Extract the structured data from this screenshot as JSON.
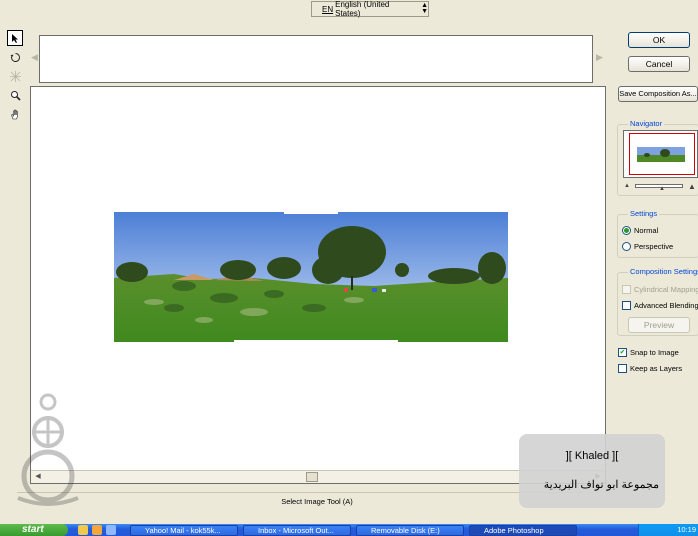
{
  "language_bar": {
    "code": "EN",
    "label": "English (United States)"
  },
  "tools": [
    {
      "name": "select-image-tool-icon"
    },
    {
      "name": "rotate-image-tool-icon"
    },
    {
      "name": "vanishing-point-tool-icon"
    },
    {
      "name": "zoom-tool-icon"
    },
    {
      "name": "hand-tool-icon"
    }
  ],
  "buttons": {
    "ok": "OK",
    "cancel": "Cancel",
    "save_composition": "Save Composition As...",
    "preview": "Preview"
  },
  "navigator": {
    "title": "Navigator"
  },
  "settings": {
    "title": "Settings",
    "options": [
      {
        "label": "Normal",
        "selected": true
      },
      {
        "label": "Perspective",
        "selected": false
      }
    ]
  },
  "composition_settings": {
    "title": "Composition Settings",
    "cylindrical_mapping": {
      "label": "Cylindrical Mapping",
      "checked": false,
      "enabled": false
    },
    "advanced_blending": {
      "label": "Advanced Blending",
      "checked": false,
      "enabled": true
    }
  },
  "snap_to_image": {
    "label": "Snap to Image",
    "checked": true
  },
  "keep_as_layers": {
    "label": "Keep as Layers",
    "checked": false
  },
  "status_text": "Select Image Tool (A)",
  "overlay": {
    "line1": "][ Khaled ][",
    "line2": "مجموعة ابو نواف البريدية"
  },
  "taskbar": {
    "start_label": "start",
    "tasks": [
      {
        "label": "Yahoo! Mail - kok55k..."
      },
      {
        "label": "Inbox - Microsoft Out..."
      },
      {
        "label": "Removable Disk (E:)"
      },
      {
        "label": "Adobe Photoshop"
      }
    ],
    "clock": "10:19"
  },
  "colors": {
    "dialog_bg": "#ece9d8",
    "group_title": "#0046d5",
    "taskbar": "#245edb",
    "start": "#379b2e",
    "navigator_view_box": "#d40000"
  }
}
